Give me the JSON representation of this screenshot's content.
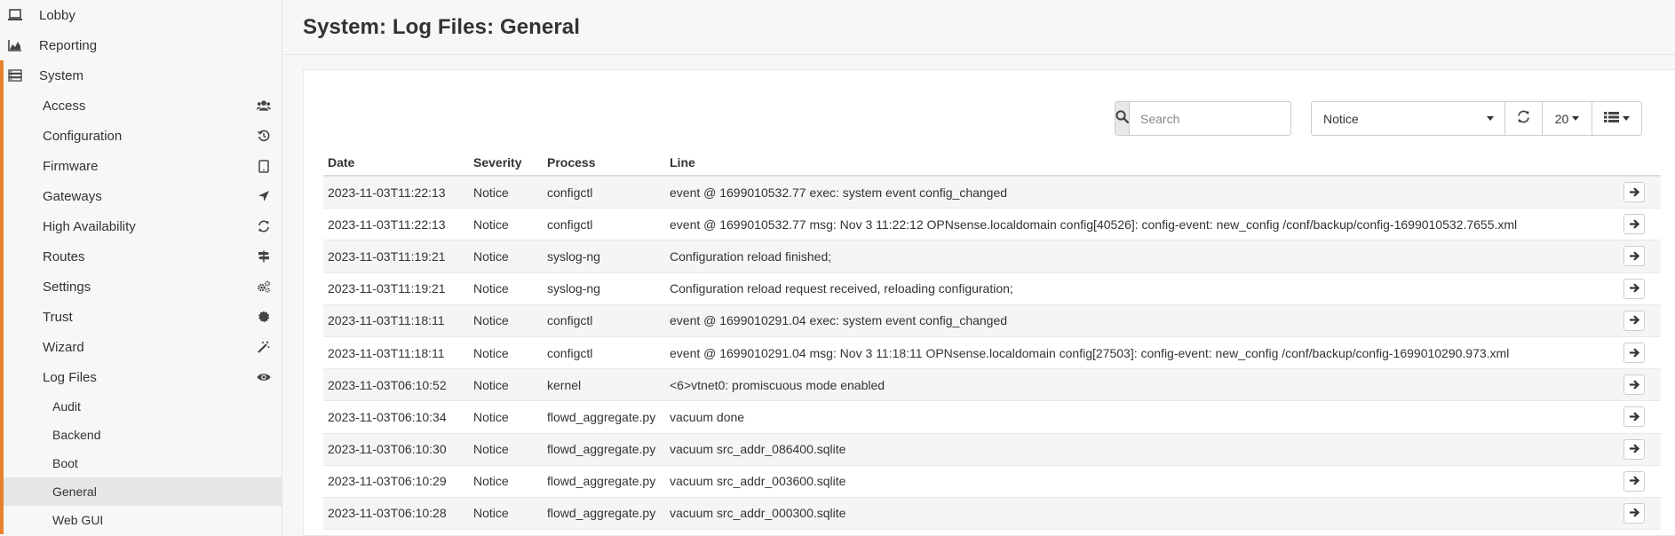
{
  "sidebar": {
    "top_items": [
      {
        "label": "Lobby",
        "icon": "laptop-icon"
      },
      {
        "label": "Reporting",
        "icon": "area-chart-icon"
      },
      {
        "label": "System",
        "icon": "server-icon"
      }
    ],
    "system_items": [
      {
        "label": "Access",
        "icon": "users-icon"
      },
      {
        "label": "Configuration",
        "icon": "history-icon"
      },
      {
        "label": "Firmware",
        "icon": "tablet-icon"
      },
      {
        "label": "Gateways",
        "icon": "location-arrow-icon"
      },
      {
        "label": "High Availability",
        "icon": "refresh-icon"
      },
      {
        "label": "Routes",
        "icon": "signpost-icon"
      },
      {
        "label": "Settings",
        "icon": "cogs-icon"
      },
      {
        "label": "Trust",
        "icon": "certificate-icon"
      },
      {
        "label": "Wizard",
        "icon": "magic-icon"
      },
      {
        "label": "Log Files",
        "icon": "eye-icon"
      }
    ],
    "logfile_items": [
      {
        "label": "Audit"
      },
      {
        "label": "Backend"
      },
      {
        "label": "Boot"
      },
      {
        "label": "General",
        "active": true
      },
      {
        "label": "Web GUI"
      }
    ]
  },
  "header": {
    "title": "System: Log Files: General"
  },
  "toolbar": {
    "search_placeholder": "Search",
    "severity_value": "Notice",
    "rows_value": "20"
  },
  "table": {
    "columns": [
      "Date",
      "Severity",
      "Process",
      "Line"
    ],
    "rows": [
      [
        "2023-11-03T11:22:13",
        "Notice",
        "configctl",
        "event @ 1699010532.77 exec: system event config_changed"
      ],
      [
        "2023-11-03T11:22:13",
        "Notice",
        "configctl",
        "event @ 1699010532.77 msg: Nov 3 11:22:12 OPNsense.localdomain config[40526]: config-event: new_config /conf/backup/config-1699010532.7655.xml"
      ],
      [
        "2023-11-03T11:19:21",
        "Notice",
        "syslog-ng",
        "Configuration reload finished;"
      ],
      [
        "2023-11-03T11:19:21",
        "Notice",
        "syslog-ng",
        "Configuration reload request received, reloading configuration;"
      ],
      [
        "2023-11-03T11:18:11",
        "Notice",
        "configctl",
        "event @ 1699010291.04 exec: system event config_changed"
      ],
      [
        "2023-11-03T11:18:11",
        "Notice",
        "configctl",
        "event @ 1699010291.04 msg: Nov 3 11:18:11 OPNsense.localdomain config[27503]: config-event: new_config /conf/backup/config-1699010290.973.xml"
      ],
      [
        "2023-11-03T06:10:52",
        "Notice",
        "kernel",
        "<6>vtnet0: promiscuous mode enabled"
      ],
      [
        "2023-11-03T06:10:34",
        "Notice",
        "flowd_aggregate.py",
        "vacuum done"
      ],
      [
        "2023-11-03T06:10:30",
        "Notice",
        "flowd_aggregate.py",
        "vacuum src_addr_086400.sqlite"
      ],
      [
        "2023-11-03T06:10:29",
        "Notice",
        "flowd_aggregate.py",
        "vacuum src_addr_003600.sqlite"
      ],
      [
        "2023-11-03T06:10:28",
        "Notice",
        "flowd_aggregate.py",
        "vacuum src_addr_000300.sqlite"
      ]
    ]
  },
  "colors": {
    "accent": "#e8822f",
    "active_bg": "#e6e6e6"
  }
}
